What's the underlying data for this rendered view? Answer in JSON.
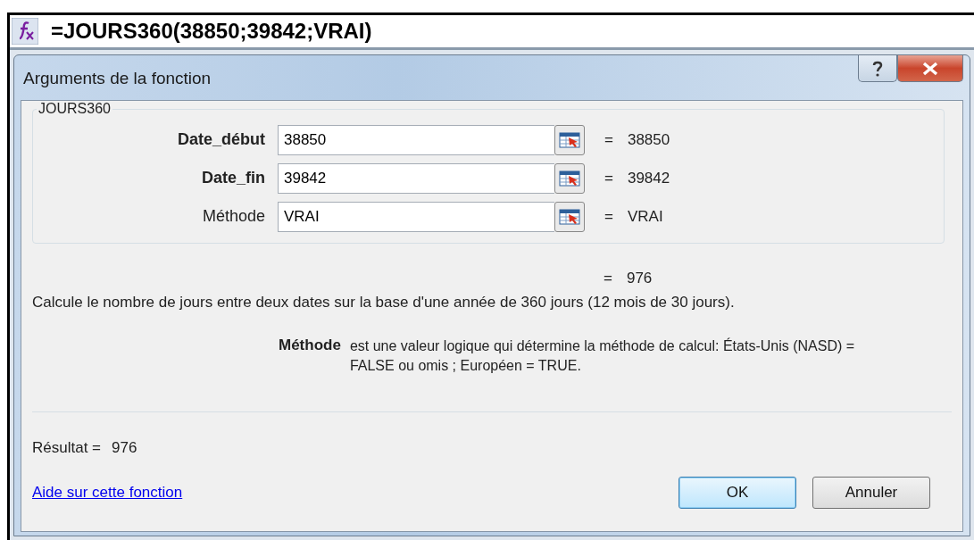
{
  "formula_bar": {
    "formula": "=JOURS360(38850;39842;VRAI)"
  },
  "dialog": {
    "title": "Arguments de la fonction"
  },
  "group": {
    "legend": "JOURS360",
    "arguments": [
      {
        "label": "Date_début",
        "required": true,
        "value": "38850",
        "sign": "=",
        "result": "38850"
      },
      {
        "label": "Date_fin",
        "required": true,
        "value": "39842",
        "sign": "=",
        "result": "39842"
      },
      {
        "label": "Méthode",
        "required": false,
        "value": "VRAI",
        "sign": "=",
        "result": "VRAI"
      }
    ]
  },
  "function_result": {
    "sign": "=",
    "value": "976"
  },
  "description": "Calcule le nombre de jours entre deux dates sur la base d'une année de 360 jours (12 mois de 30 jours).",
  "argument_help": {
    "name": "Méthode",
    "text": "est une valeur logique qui détermine la méthode de calcul: États-Unis (NASD) = FALSE ou omis ; Européen = TRUE."
  },
  "result": {
    "label": "Résultat =",
    "value": "976"
  },
  "help_link": "Aide sur cette fonction",
  "buttons": [
    {
      "label": "OK",
      "default": true
    },
    {
      "label": "Annuler",
      "default": false
    }
  ]
}
